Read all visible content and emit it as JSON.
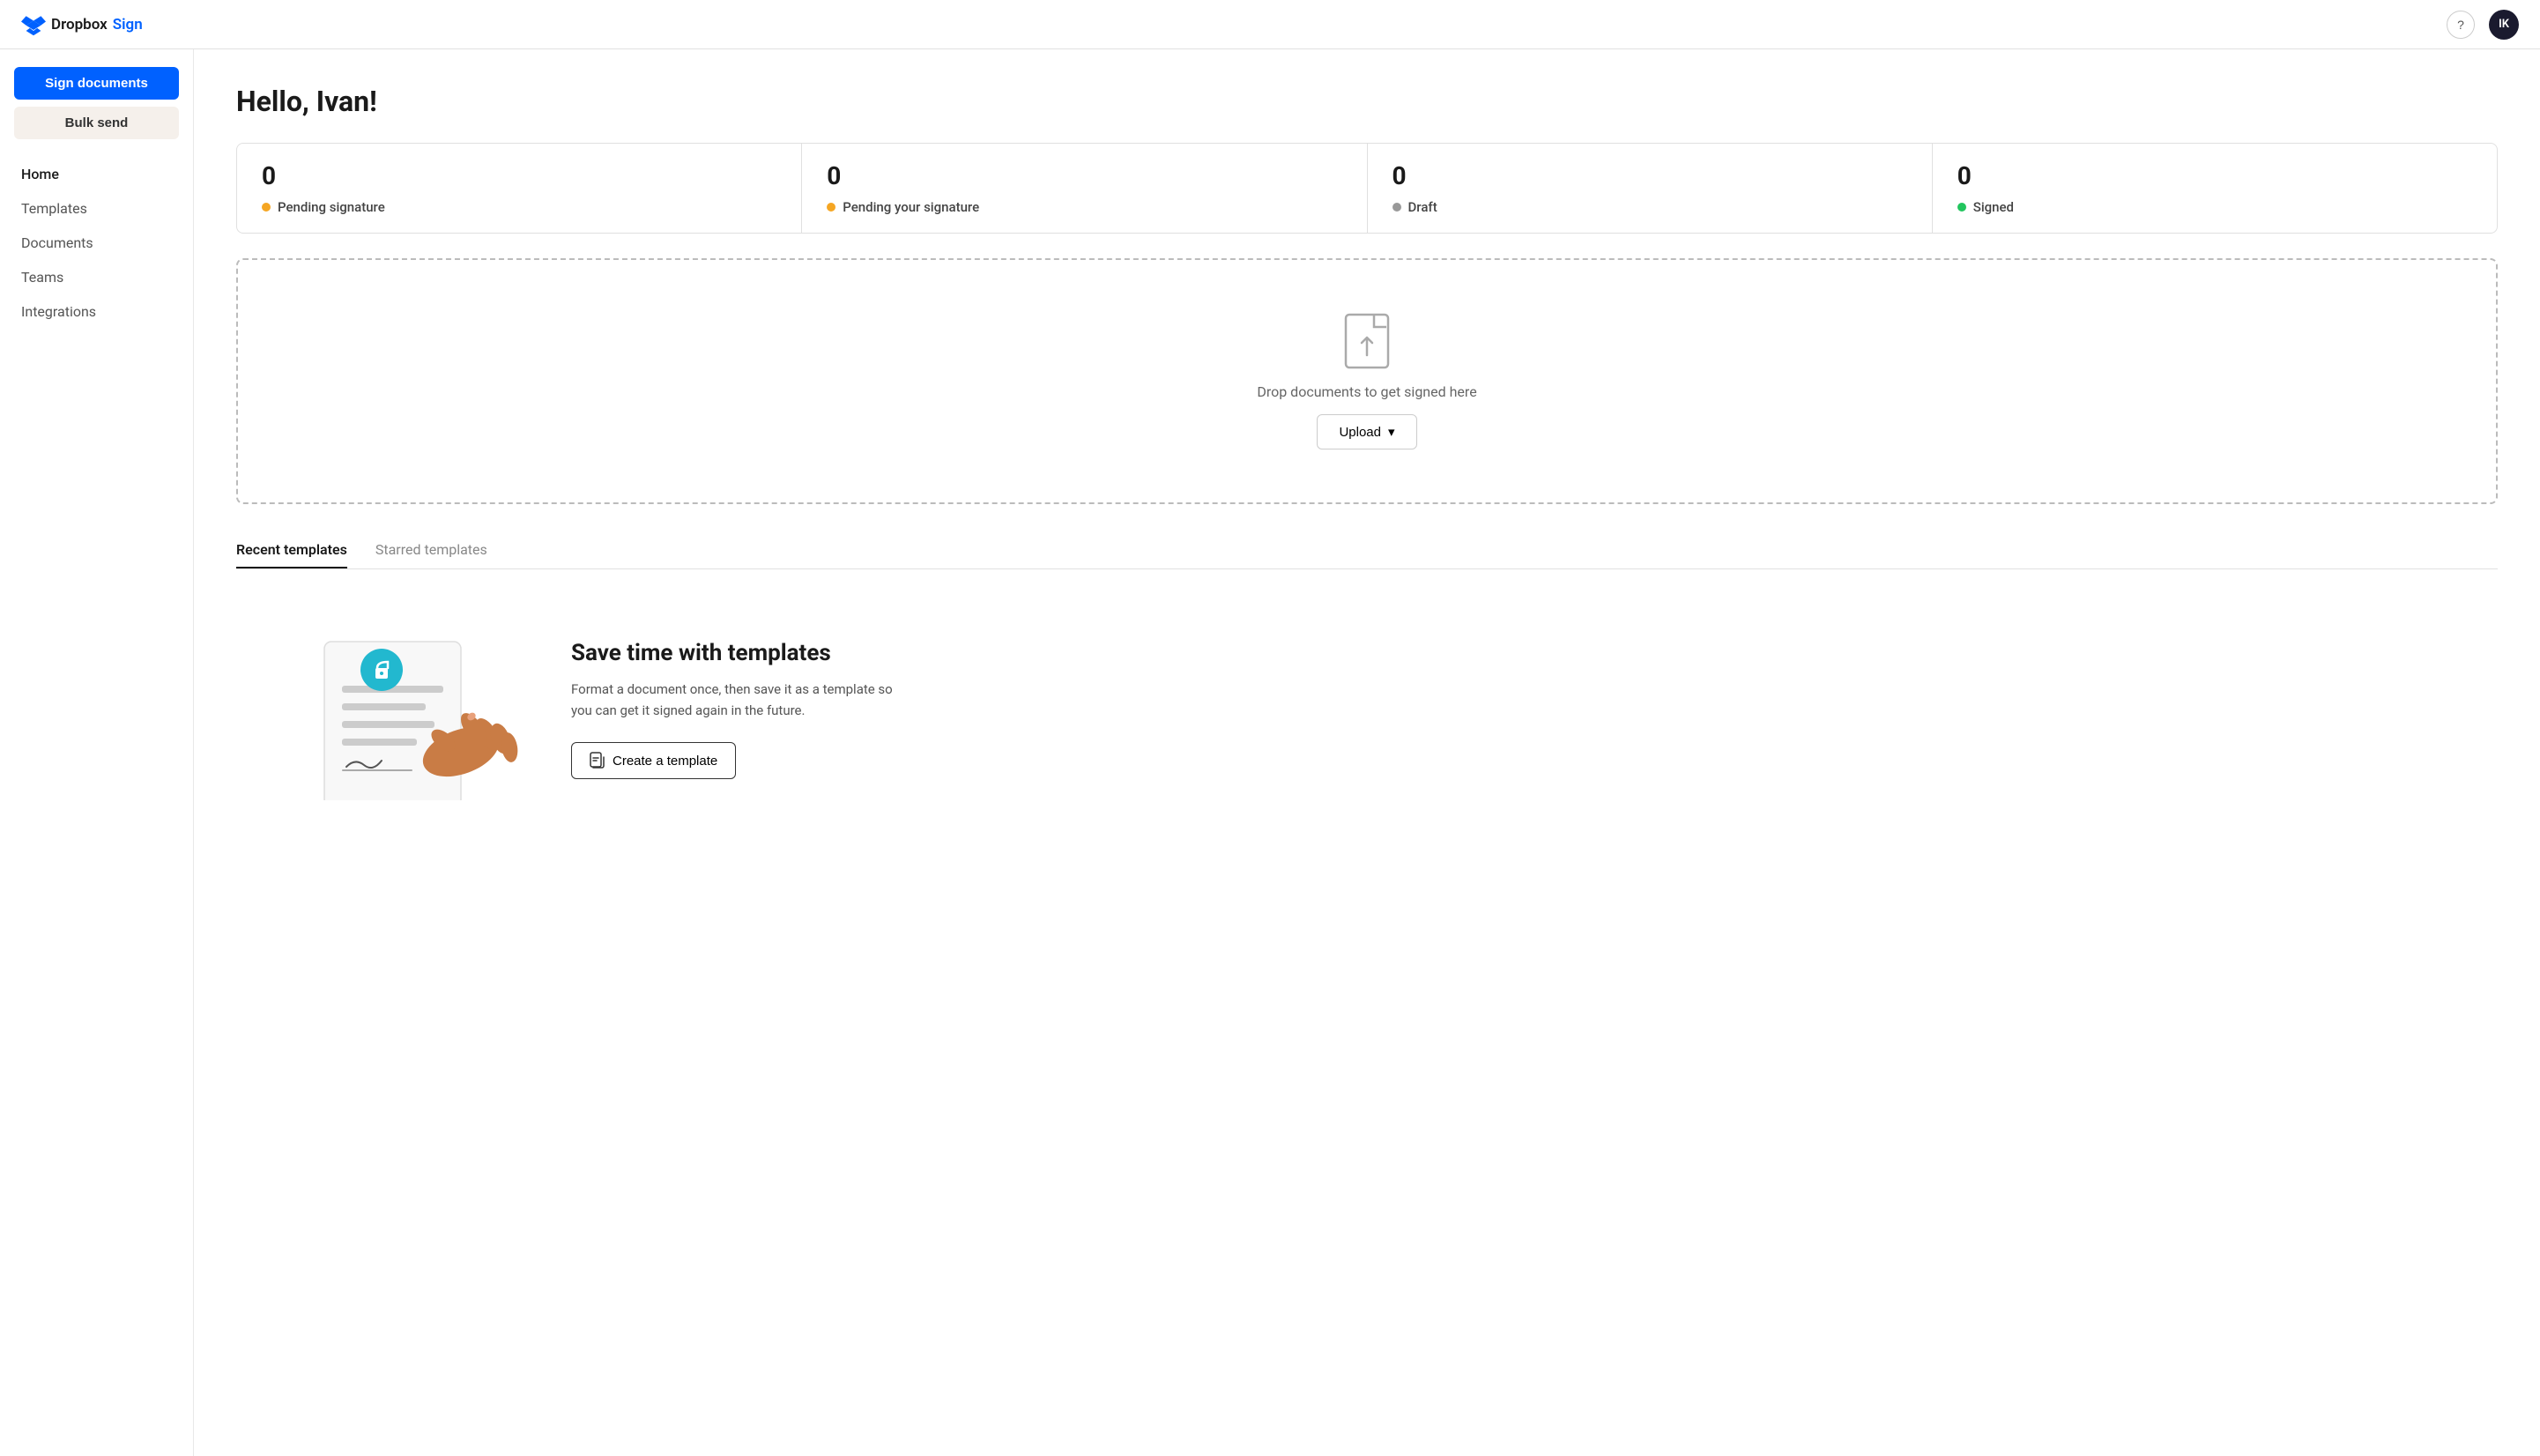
{
  "topbar": {
    "logo_text_dropbox": "Dropbox",
    "logo_text_sign": "Sign",
    "help_label": "?",
    "avatar_initials": "IK"
  },
  "sidebar": {
    "sign_documents_label": "Sign documents",
    "bulk_send_label": "Bulk send",
    "nav_items": [
      {
        "id": "home",
        "label": "Home",
        "active": true
      },
      {
        "id": "templates",
        "label": "Templates",
        "active": false
      },
      {
        "id": "documents",
        "label": "Documents",
        "active": false
      },
      {
        "id": "teams",
        "label": "Teams",
        "active": false
      },
      {
        "id": "integrations",
        "label": "Integrations",
        "active": false
      }
    ]
  },
  "main": {
    "greeting": "Hello, Ivan!",
    "stats": [
      {
        "count": "0",
        "label": "Pending signature",
        "dot_class": "dot-yellow"
      },
      {
        "count": "0",
        "label": "Pending your signature",
        "dot_class": "dot-yellow"
      },
      {
        "count": "0",
        "label": "Draft",
        "dot_class": "dot-gray"
      },
      {
        "count": "0",
        "label": "Signed",
        "dot_class": "dot-green"
      }
    ],
    "drop_zone_text": "Drop documents to get signed here",
    "upload_button_label": "Upload",
    "upload_chevron": "▾",
    "tabs": [
      {
        "id": "recent",
        "label": "Recent templates",
        "active": true
      },
      {
        "id": "starred",
        "label": "Starred templates",
        "active": false
      }
    ],
    "promo": {
      "heading": "Save time with templates",
      "body": "Format a document once, then save it as a template so you can get it signed again in the future.",
      "create_button_label": "Create a template"
    }
  }
}
